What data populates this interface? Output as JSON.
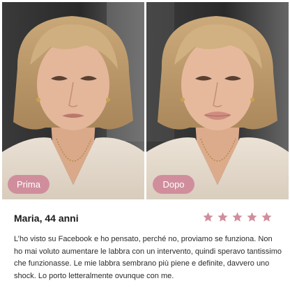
{
  "before_after": {
    "before_label": "Prima",
    "after_label": "Dopo"
  },
  "review": {
    "name": "Maria, 44 anni",
    "rating": 5,
    "rating_max": 5,
    "star_color": "#d08e9d",
    "text": "L’ho visto su Facebook e ho pensato, perché no, proviamo se funziona. Non ho mai voluto aumentare le labbra con un intervento, quindi speravo tantissimo che funzionasse. Le mie labbra sembrano più piene e definite, davvero uno shock. Lo porto letteralmente ovunque con me."
  }
}
